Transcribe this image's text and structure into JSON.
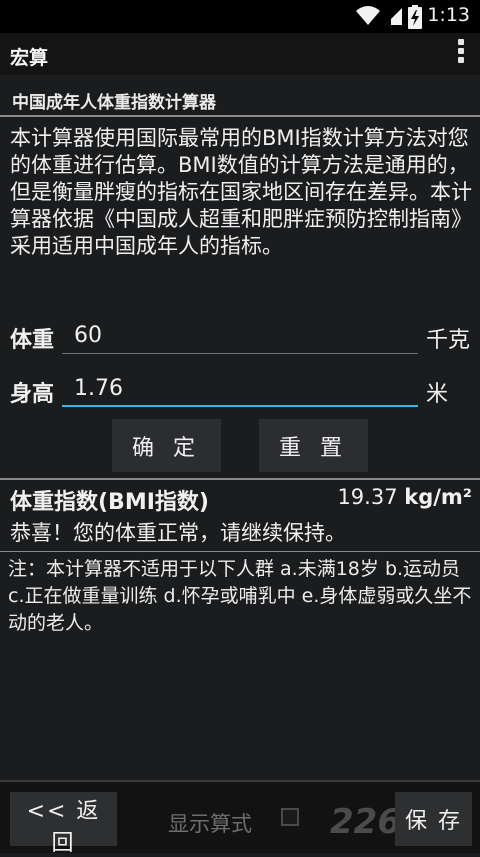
{
  "status_bar": {
    "time": "1:13"
  },
  "action_bar": {
    "title": "宏算"
  },
  "section_header": "中国成年人体重指数计算器",
  "intro": "本计算器使用国际最常用的BMI指数计算方法对您的体重进行估算。BMI数值的计算方法是通用的，但是衡量胖瘦的指标在国家地区间存在差异。本计算器依据《中国成人超重和肥胖症预防控制指南》采用适用中国成年人的指标。",
  "weight": {
    "label": "体重",
    "value": "60",
    "unit": "千克"
  },
  "height": {
    "label": "身高",
    "value": "1.76",
    "unit": "米"
  },
  "buttons": {
    "confirm": "确 定",
    "reset": "重 置"
  },
  "result": {
    "label": "体重指数(BMI指数)",
    "value": "19.37",
    "unit": "kg/m²",
    "message": "恭喜！您的体重正常，请继续保持。"
  },
  "note": "注：本计算器不适用于以下人群 a.未满18岁 b.运动员 c.正在做重量训练 d.怀孕或哺乳中 e.身体虚弱或久坐不动的老人。",
  "bottom_bar": {
    "back": "<< 返 回",
    "show_formula": "显示算式",
    "save": "保 存",
    "watermark": "226"
  },
  "colors": {
    "accent": "#33b5e5",
    "background": "#1b1c1e"
  }
}
